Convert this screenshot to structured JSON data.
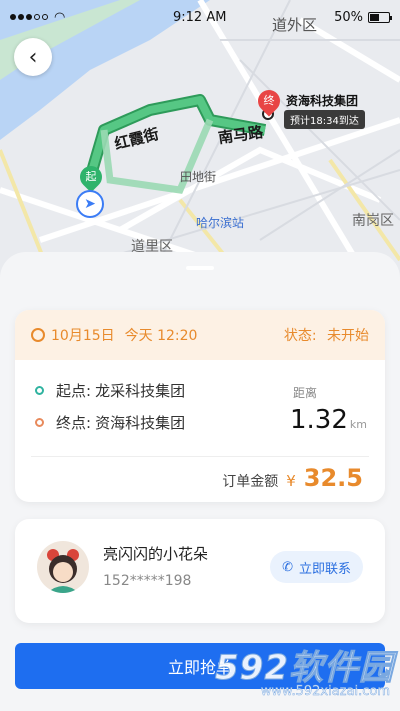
{
  "status_bar": {
    "time": "9:12 AM",
    "battery": "50%",
    "battery_level": 0.5
  },
  "map": {
    "districts": [
      "道外区",
      "道里区",
      "南岗区"
    ],
    "roads": [
      "红霞街",
      "南马路",
      "田地街"
    ],
    "station": "哈尔滨站",
    "destination": "资海科技集团",
    "eta": "预计18:34到达",
    "start_pin": "起",
    "end_pin": "终"
  },
  "order": {
    "date": "10月15日",
    "time": "今天 12:20",
    "status_label": "状态:",
    "status_value": "未开始",
    "start_key": "起点:",
    "start_place": "龙采科技集团",
    "end_key": "终点:",
    "end_place": "资海科技集团",
    "distance_label": "距离",
    "distance_value": "1.32",
    "distance_unit": "km",
    "amount_label": "订单金额",
    "currency": "¥",
    "amount_value": "32.5"
  },
  "user": {
    "name": "亮闪闪的小花朵",
    "phone": "152*****198",
    "contact_label": "立即联系"
  },
  "action": {
    "grab_label": "立即抢单"
  },
  "watermark": {
    "brand": "592软件园",
    "url": "www.592xiazai.com"
  },
  "colors": {
    "accent": "#1e6ef0",
    "orange": "#e88a2c",
    "route": "#3cb56e"
  }
}
